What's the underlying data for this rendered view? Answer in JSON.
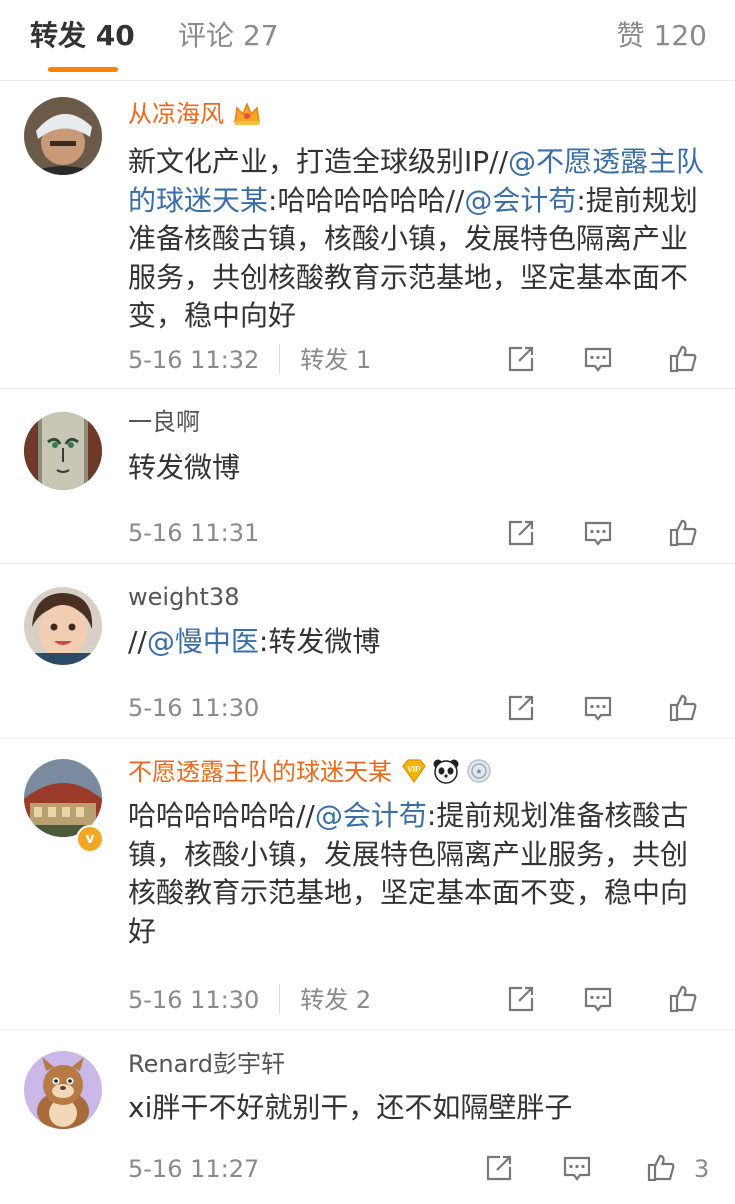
{
  "tabs": {
    "repost": "转发 40",
    "comment": "评论 27",
    "like": "赞 120"
  },
  "posts": [
    {
      "name": "从凉海风",
      "text_parts": [
        {
          "t": "新文化产业，打造全球级别IP//"
        },
        {
          "t": "@不愿透露主队的球迷天某",
          "mention": true
        },
        {
          "t": ":哈哈哈哈哈哈//"
        },
        {
          "t": "@会计苟",
          "mention": true
        },
        {
          "t": ":提前规划准备核酸古镇，核酸小镇，发展特色隔离产业服务，共创核酸教育示范基地，坚定基本面不变，稳中向好"
        }
      ],
      "time": "5-16 11:32",
      "repost": "转发 1"
    },
    {
      "name": "一良啊",
      "text_parts": [
        {
          "t": "转发微博"
        }
      ],
      "time": "5-16 11:31"
    },
    {
      "name": "weight38",
      "text_parts": [
        {
          "t": "//"
        },
        {
          "t": "@慢中医",
          "mention": true
        },
        {
          "t": ":转发微博"
        }
      ],
      "time": "5-16 11:30"
    },
    {
      "name": "不愿透露主队的球迷天某",
      "verified_badge": "v",
      "text_parts": [
        {
          "t": "哈哈哈哈哈哈//"
        },
        {
          "t": "@会计苟",
          "mention": true
        },
        {
          "t": ":提前规划准备核酸古镇，核酸小镇，发展特色隔离产业服务，共创核酸教育示范基地，坚定基本面不变，稳中向好"
        }
      ],
      "time": "5-16 11:30",
      "repost": "转发 2"
    },
    {
      "name": "Renard彭宇轩",
      "text_parts": [
        {
          "t": "xi胖干不好就别干，还不如隔壁胖子"
        }
      ],
      "time": "5-16 11:27",
      "likes": "3"
    }
  ],
  "colors": {
    "accent": "#ff8200",
    "mention": "#3b6ea5",
    "vip_name": "#e86a1d",
    "muted": "#8a8a8a"
  },
  "icons": [
    "crown-icon",
    "vip-diamond-icon",
    "panda-icon",
    "medal-icon",
    "verified-icon",
    "repost-icon",
    "comment-icon",
    "like-icon"
  ]
}
